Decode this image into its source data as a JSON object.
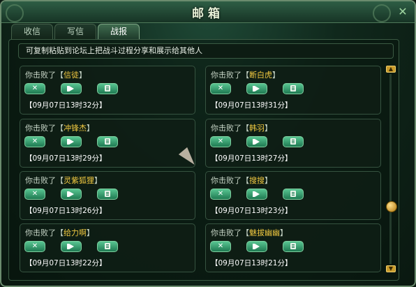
{
  "window": {
    "title": "邮箱",
    "close_icon": "close-icon"
  },
  "tabs": [
    {
      "label": "收信",
      "active": false
    },
    {
      "label": "写信",
      "active": false
    },
    {
      "label": "战报",
      "active": true
    }
  ],
  "notice": "可复制粘贴到论坛上把战斗过程分享和展示给其他人",
  "prefix_open": "你击败了【",
  "prefix_close": "】",
  "reports": [
    {
      "name": "信徒",
      "time": "【09月07日13时32分】"
    },
    {
      "name": "断白虎",
      "time": "【09月07日13时31分】"
    },
    {
      "name": "冲锋杰",
      "time": "【09月07日13时29分】"
    },
    {
      "name": "韩羽",
      "time": "【09月07日13时27分】"
    },
    {
      "name": "灵紫狐狸",
      "time": "【09月07日13时26分】"
    },
    {
      "name": "搜搜",
      "time": "【09月07日13时23分】"
    },
    {
      "name": "给力啊",
      "time": "【09月07日13时22分】"
    },
    {
      "name": "魅拔幽幽",
      "time": "【09月07日13时21分】"
    }
  ],
  "icons": {
    "delete": "x-icon",
    "replay": "play-icon",
    "copy": "document-icon"
  },
  "colors": {
    "name": "#f0c840",
    "accent": "#3f6b4f"
  },
  "scroll": {
    "position_fraction": 0.7
  }
}
